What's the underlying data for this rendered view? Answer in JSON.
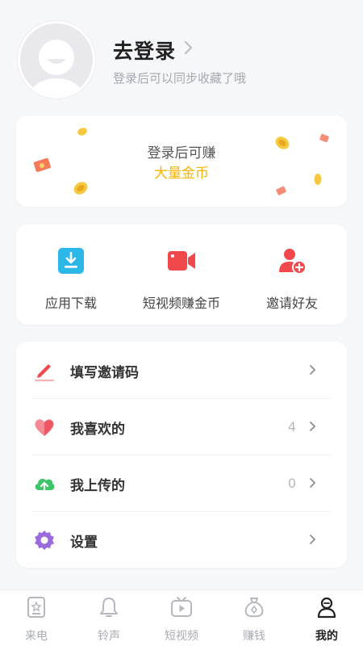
{
  "profile": {
    "title": "去登录",
    "subtitle": "登录后可以同步收藏了哦"
  },
  "banner": {
    "line1": "登录后可赚",
    "line2": "大量金币",
    "accent_color": "#f4b400"
  },
  "quick_actions": [
    {
      "label": "应用下载",
      "icon": "download-icon",
      "color": "#2bb7e8"
    },
    {
      "label": "短视频赚金币",
      "icon": "video-camera-icon",
      "color": "#f0484b"
    },
    {
      "label": "邀请好友",
      "icon": "add-user-icon",
      "color": "#f0484b"
    }
  ],
  "menu": [
    {
      "label": "填写邀请码",
      "icon": "pencil-icon",
      "count": ""
    },
    {
      "label": "我喜欢的",
      "icon": "heart-icon",
      "count": "4"
    },
    {
      "label": "我上传的",
      "icon": "cloud-upload-icon",
      "count": "0"
    },
    {
      "label": "设置",
      "icon": "gear-icon",
      "count": ""
    }
  ],
  "tabbar": [
    {
      "label": "来电",
      "icon": "phone-card-icon",
      "active": false
    },
    {
      "label": "铃声",
      "icon": "bell-icon",
      "active": false
    },
    {
      "label": "短视频",
      "icon": "tv-play-icon",
      "active": false
    },
    {
      "label": "赚钱",
      "icon": "money-bag-icon",
      "active": false
    },
    {
      "label": "我的",
      "icon": "user-icon",
      "active": true
    }
  ]
}
